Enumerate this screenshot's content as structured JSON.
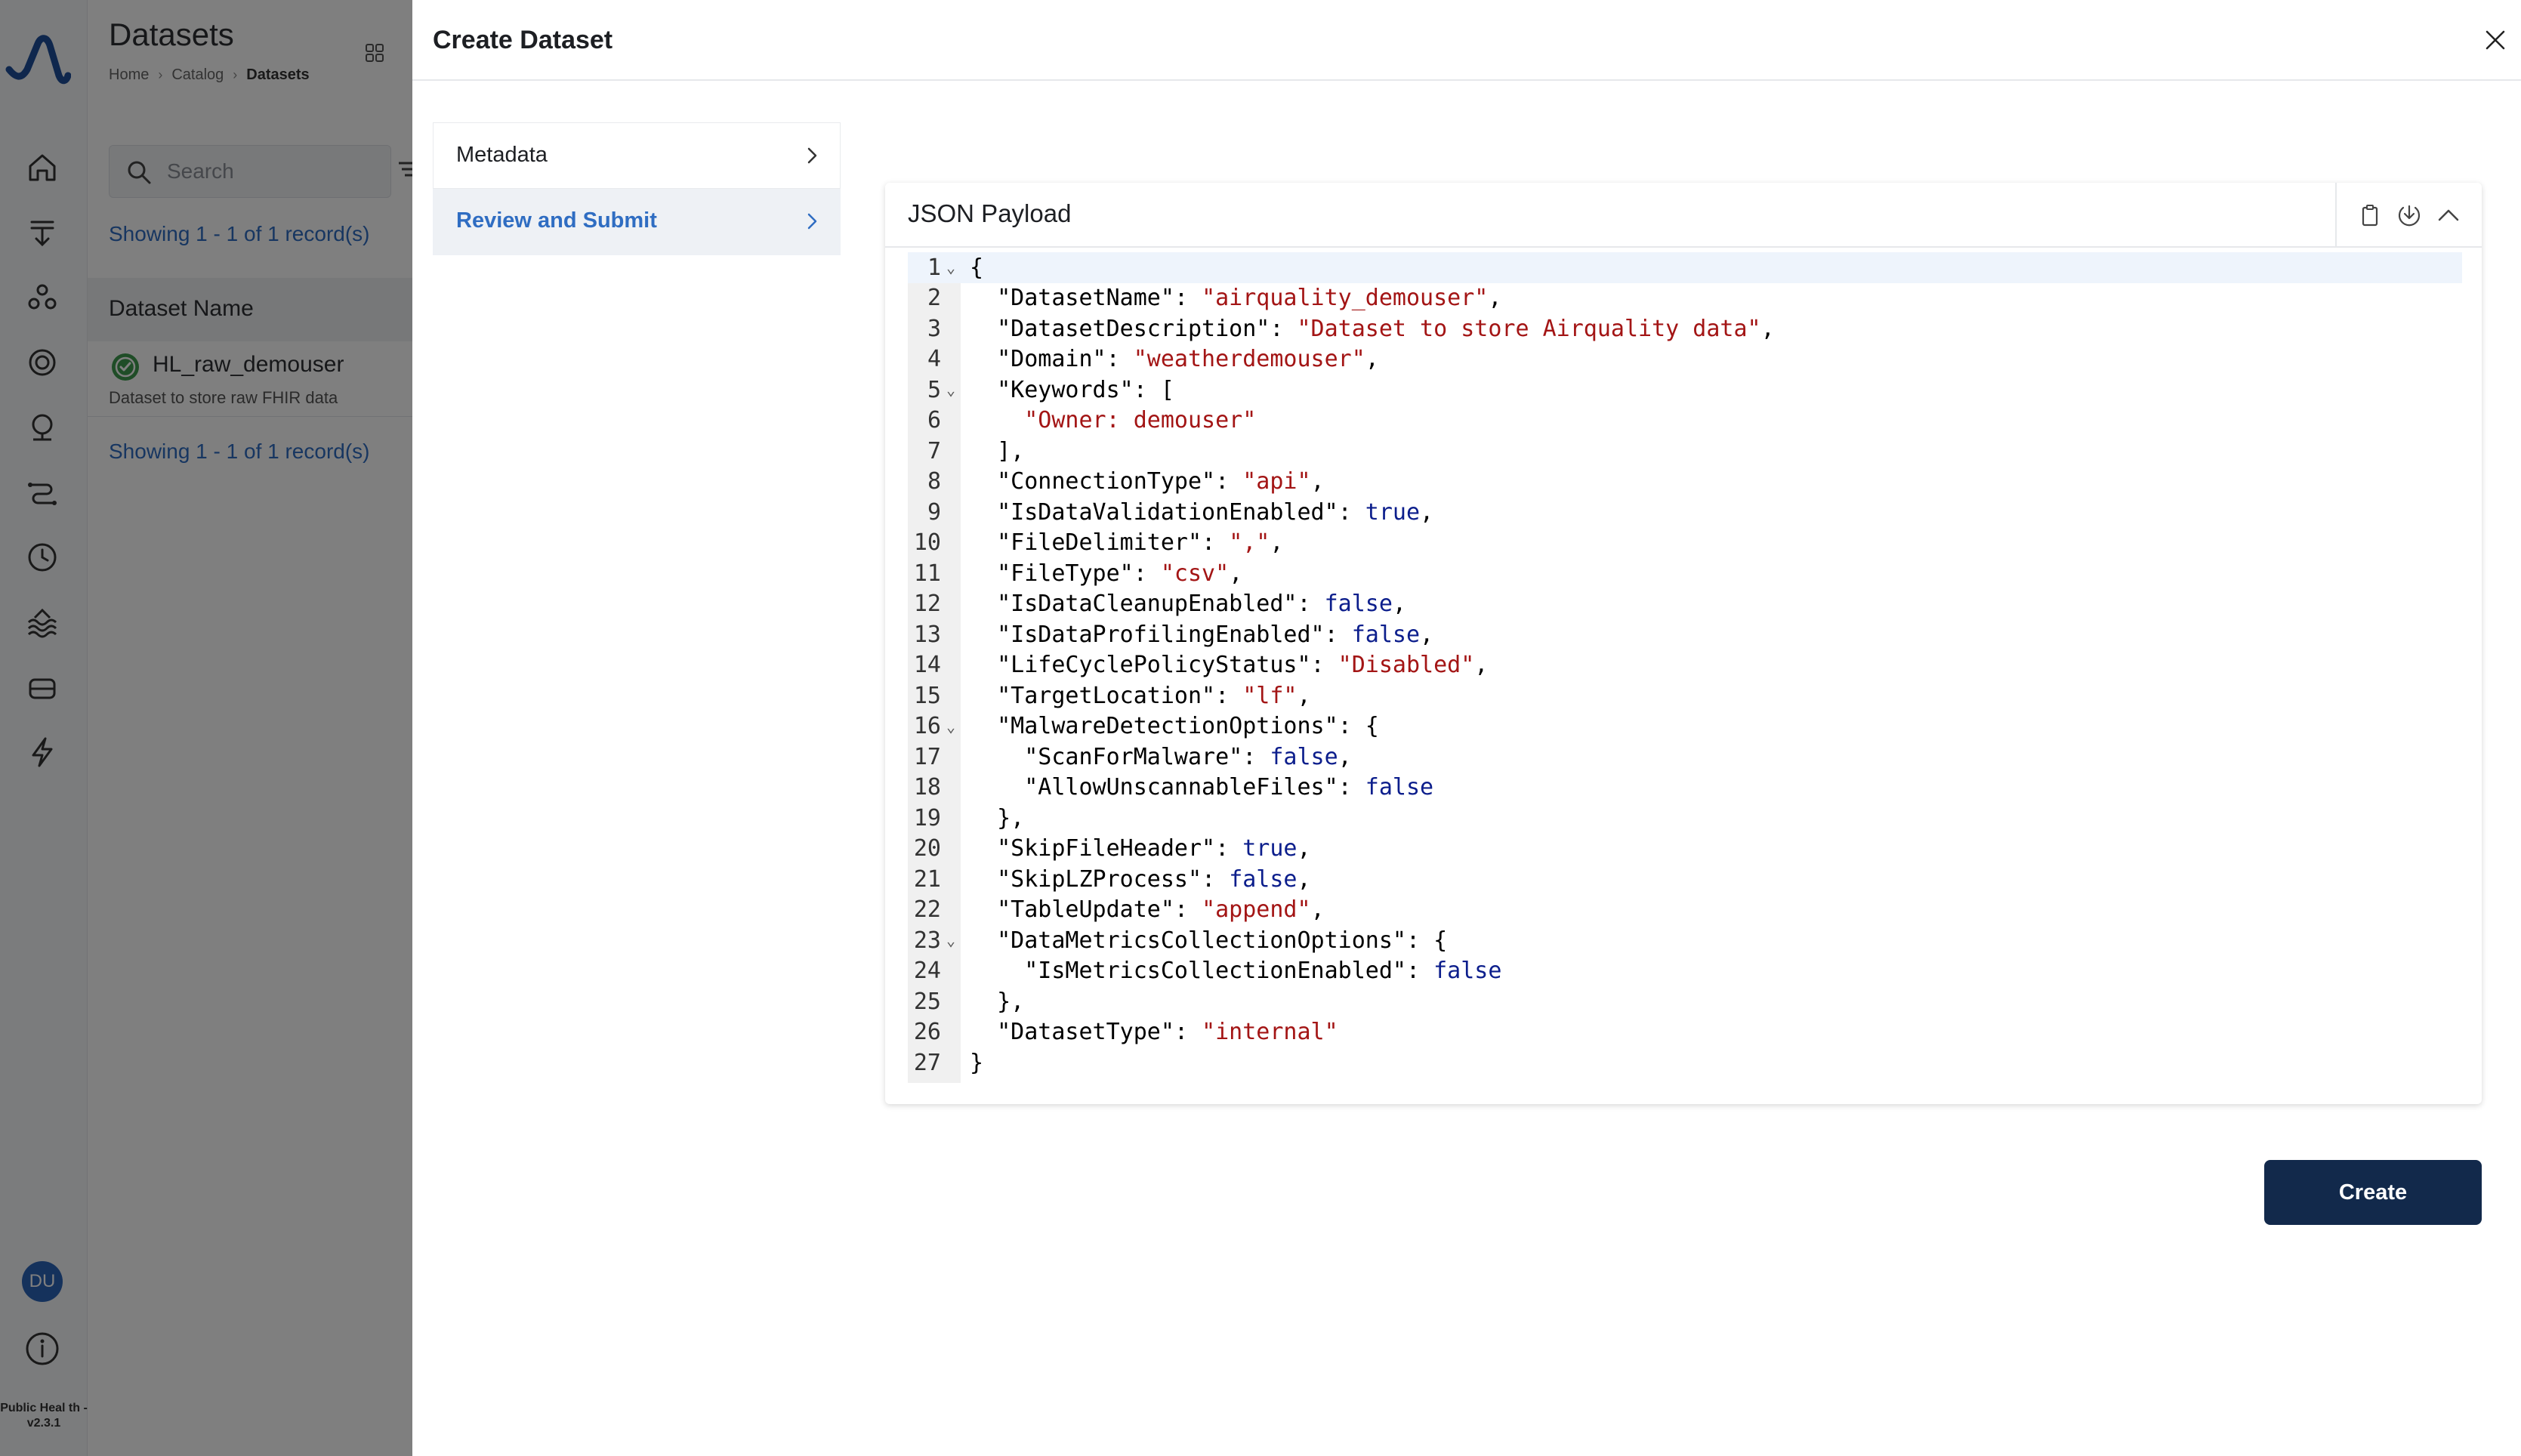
{
  "background": {
    "page_title": "Datasets",
    "breadcrumb": [
      "Home",
      "Catalog",
      "Datasets"
    ],
    "search_placeholder": "Search",
    "showing_top": "Showing 1 - 1 of 1 record(s)",
    "showing_bottom": "Showing 1 - 1 of 1 record(s)",
    "column_header": "Dataset Name",
    "rows": [
      {
        "name": "HL_raw_demouser",
        "description": "Dataset to store raw FHIR data",
        "status": "success"
      }
    ],
    "avatar_initials": "DU",
    "version": "Public Heal th - v2.3.1"
  },
  "nav_icons": [
    "home-icon",
    "ingest-icon",
    "users-icon",
    "target-icon",
    "monitor-icon",
    "pipeline-icon",
    "clock-icon",
    "lake-icon",
    "storage-icon",
    "lightning-icon"
  ],
  "drawer": {
    "title": "Create Dataset",
    "steps": [
      {
        "label": "Metadata",
        "active": false
      },
      {
        "label": "Review and Submit",
        "active": true
      }
    ],
    "card_title": "JSON Payload",
    "card_actions": [
      "copy-icon",
      "download-icon",
      "collapse-icon"
    ],
    "create_label": "Create"
  },
  "json_lines": [
    {
      "n": "1",
      "fold": true,
      "text": "{"
    },
    {
      "n": "2",
      "text": "  \"DatasetName\": \"airquality_demouser\","
    },
    {
      "n": "3",
      "text": "  \"DatasetDescription\": \"Dataset to store Airquality data\","
    },
    {
      "n": "4",
      "text": "  \"Domain\": \"weatherdemouser\","
    },
    {
      "n": "5",
      "fold": true,
      "text": "  \"Keywords\": ["
    },
    {
      "n": "6",
      "text": "    \"Owner: demouser\""
    },
    {
      "n": "7",
      "text": "  ],"
    },
    {
      "n": "8",
      "text": "  \"ConnectionType\": \"api\","
    },
    {
      "n": "9",
      "text": "  \"IsDataValidationEnabled\": true,"
    },
    {
      "n": "10",
      "text": "  \"FileDelimiter\": \",\","
    },
    {
      "n": "11",
      "text": "  \"FileType\": \"csv\","
    },
    {
      "n": "12",
      "text": "  \"IsDataCleanupEnabled\": false,"
    },
    {
      "n": "13",
      "text": "  \"IsDataProfilingEnabled\": false,"
    },
    {
      "n": "14",
      "text": "  \"LifeCyclePolicyStatus\": \"Disabled\","
    },
    {
      "n": "15",
      "text": "  \"TargetLocation\": \"lf\","
    },
    {
      "n": "16",
      "fold": true,
      "text": "  \"MalwareDetectionOptions\": {"
    },
    {
      "n": "17",
      "text": "    \"ScanForMalware\": false,"
    },
    {
      "n": "18",
      "text": "    \"AllowUnscannableFiles\": false"
    },
    {
      "n": "19",
      "text": "  },"
    },
    {
      "n": "20",
      "text": "  \"SkipFileHeader\": true,"
    },
    {
      "n": "21",
      "text": "  \"SkipLZProcess\": false,"
    },
    {
      "n": "22",
      "text": "  \"TableUpdate\": \"append\","
    },
    {
      "n": "23",
      "fold": true,
      "text": "  \"DataMetricsCollectionOptions\": {"
    },
    {
      "n": "24",
      "text": "    \"IsMetricsCollectionEnabled\": false"
    },
    {
      "n": "25",
      "text": "  },"
    },
    {
      "n": "26",
      "text": "  \"DatasetType\": \"internal\""
    },
    {
      "n": "27",
      "text": "}"
    }
  ],
  "colors": {
    "primary_button": "#12294b",
    "active_step_text": "#2f6dc2",
    "json_string": "#a31515",
    "json_keyword": "#0c1e8c"
  }
}
